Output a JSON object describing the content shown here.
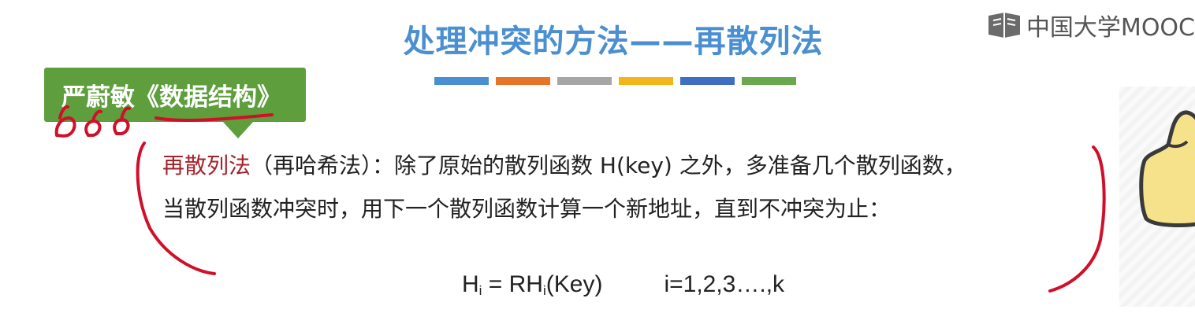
{
  "slide": {
    "title": "处理冲突的方法——再散列法",
    "book_tag": "严蔚敏《数据结构》",
    "logo_text": "中国大学MOOC",
    "body_term": "再散列法",
    "body_line1_rest": "（再哈希法）：除了原始的散列函数 H(key) 之外，多准备几个散列函数，",
    "body_line2": "当散列函数冲突时，用下一个散列函数计算一个新地址，直到不冲突为止：",
    "formula": {
      "lhs": "H",
      "lhs_sub": "i",
      "eq": " = RH",
      "rhs_sub": "i",
      "rhs_arg": "(Key)",
      "range": "i=1,2,3….,k"
    },
    "colors": {
      "title": "#4a8fd1",
      "tag_bg": "#5e9e3c",
      "term": "#a4222a",
      "annotation": "#d0102a",
      "bars": [
        "#4a8fd1",
        "#e8742a",
        "#a6a6a6",
        "#f2b51c",
        "#3f6fc2",
        "#6aa84f"
      ]
    }
  }
}
